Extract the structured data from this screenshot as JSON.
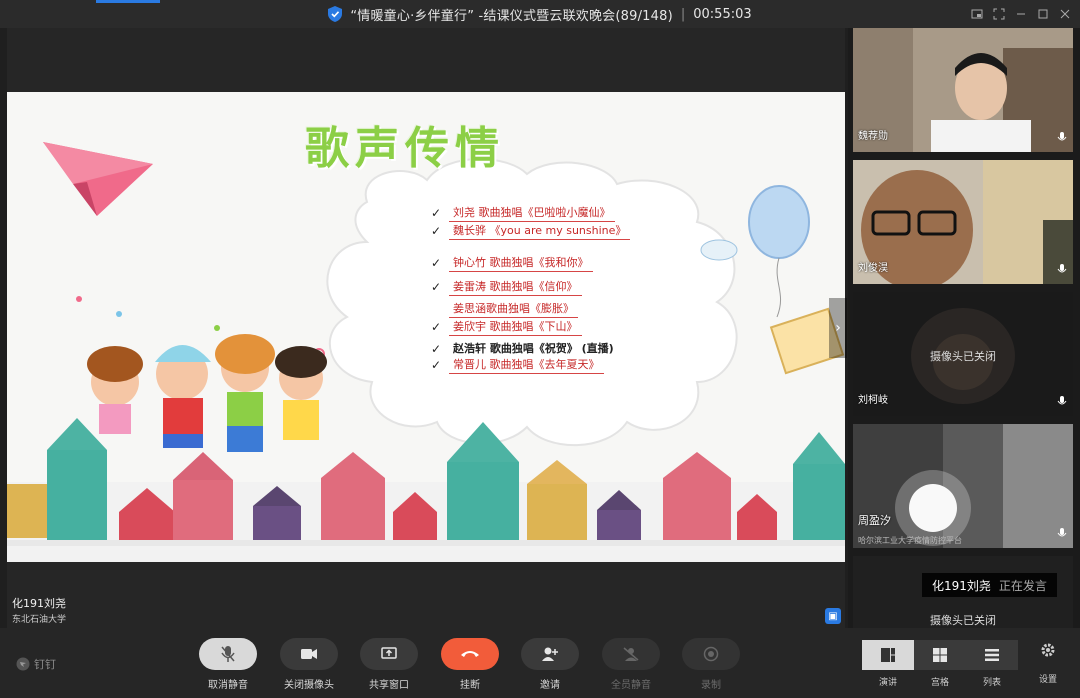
{
  "titlebar": {
    "title": "“情暖童心·乡伴童行” -结课仪式暨云联欢晚会(89/148)",
    "separator": "|",
    "timer": "00:55:03"
  },
  "stage": {
    "speaker_name": "化191刘尧",
    "speaker_org": "东北石油大学",
    "slide": {
      "title": "歌声传情",
      "program": [
        {
          "text": "刘尧  歌曲独唱《巴啦啦小魔仙》",
          "checked": true
        },
        {
          "text": "魏长骅  《you are my sunshine》",
          "checked": true
        },
        {
          "text": "钟心竹  歌曲独唱《我和你》",
          "checked": true
        },
        {
          "text": "姜雷涛  歌曲独唱《信仰》",
          "checked": true
        },
        {
          "text": "姜思涵歌曲独唱《膨胀》",
          "checked": false
        },
        {
          "text": "姜欣宇  歌曲独唱《下山》",
          "checked": true
        },
        {
          "text": "赵浩轩  歌曲独唱《祝贺》  (直播)",
          "checked": true
        },
        {
          "text": "常晋儿  歌曲独唱《去年夏天》",
          "checked": true
        }
      ]
    }
  },
  "participants": [
    {
      "name": "魏荐勋",
      "camera_off": false
    },
    {
      "name": "刘俊淏",
      "camera_off": false
    },
    {
      "name": "刘柯岐",
      "camera_off": true,
      "camera_off_text": "摄像头已关闭"
    },
    {
      "name": "周盈汐",
      "org": "哈尔滨工业大学疫情防控平台",
      "camera_off": false
    },
    {
      "name": "",
      "camera_off": true,
      "camera_off_text": "摄像头已关闭"
    }
  ],
  "speaking": {
    "name": "化191刘尧",
    "state": "正在发言"
  },
  "toolbar": {
    "brand": "钉钉",
    "buttons": [
      {
        "label": "取消静音"
      },
      {
        "label": "关闭摄像头"
      },
      {
        "label": "共享窗口"
      },
      {
        "label": "挂断"
      },
      {
        "label": "邀请"
      },
      {
        "label": "全员静音"
      },
      {
        "label": "录制"
      }
    ],
    "views": [
      {
        "label": "演讲"
      },
      {
        "label": "宫格"
      },
      {
        "label": "列表"
      }
    ],
    "settings_label": "设置"
  },
  "colors": {
    "accent": "#2a7ae2",
    "hangup": "#f25c3a",
    "slide_title": "#8ccf46",
    "program_text": "#c62828"
  }
}
